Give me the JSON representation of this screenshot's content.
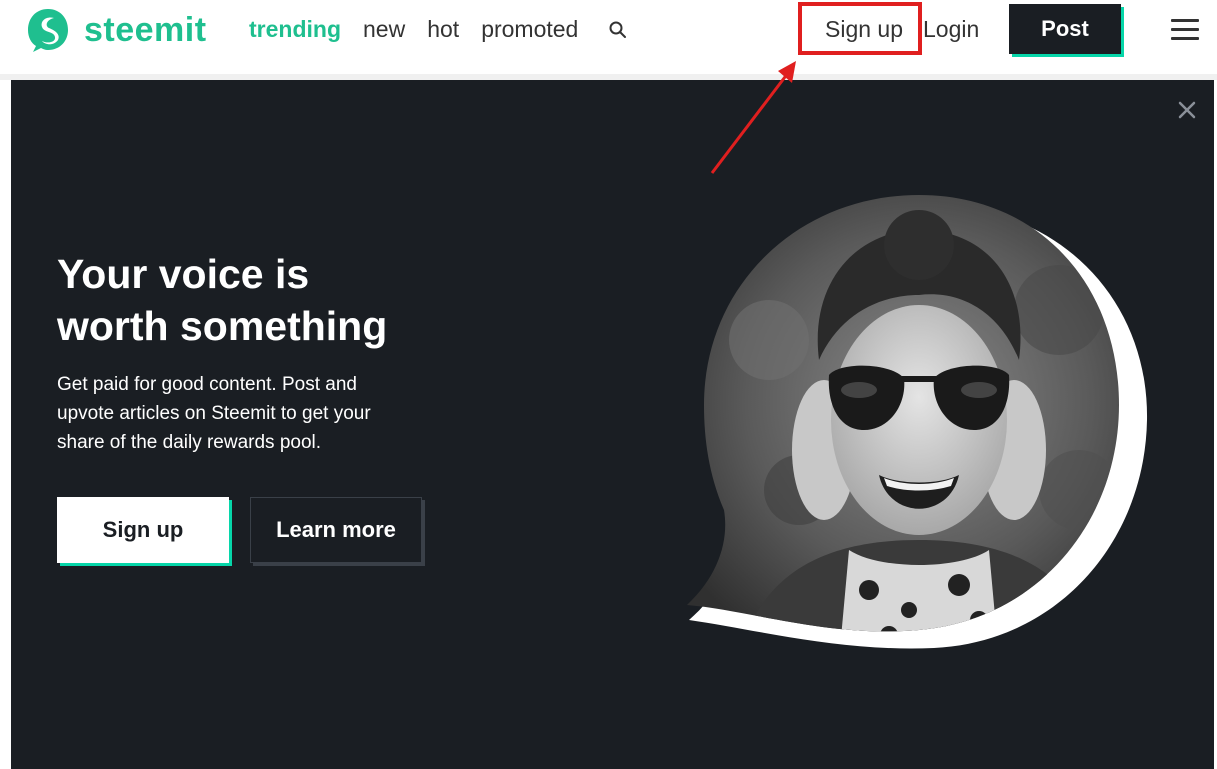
{
  "header": {
    "logo_text": "steemit",
    "nav": [
      {
        "label": "trending",
        "active": true
      },
      {
        "label": "new",
        "active": false
      },
      {
        "label": "hot",
        "active": false
      },
      {
        "label": "promoted",
        "active": false
      }
    ],
    "signup_label": "Sign up",
    "login_label": "Login",
    "post_label": "Post"
  },
  "hero": {
    "title_line1": "Your voice is",
    "title_line2": "worth something",
    "subtitle_line1": "Get paid for good content. Post and",
    "subtitle_line2": "upvote articles on Steemit to get your",
    "subtitle_line3": "share of the daily rewards pool.",
    "signup_label": "Sign up",
    "learn_more_label": "Learn more"
  },
  "icons": {
    "logo": "steemit-logo-icon",
    "search": "search-icon",
    "menu": "hamburger-menu-icon",
    "close": "close-icon"
  },
  "colors": {
    "brand": "#1fbf8f",
    "accent": "#06d6a9",
    "dark": "#1a1e23",
    "annotation": "#e01f1f"
  }
}
